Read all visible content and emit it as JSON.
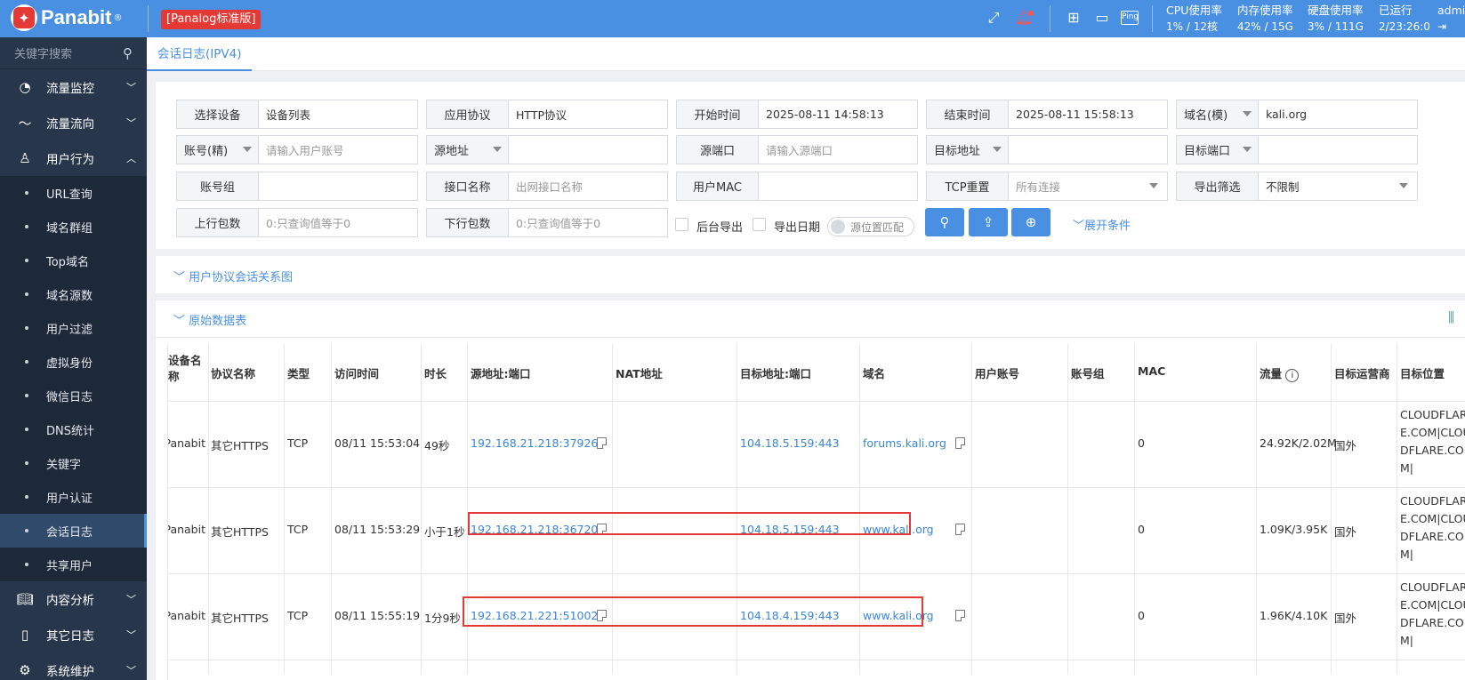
{
  "topbar": {
    "brand": "Panabit",
    "reg": "®",
    "edition": "[Panalog标准版]",
    "stats": [
      {
        "label": "CPU使用率",
        "value": "1% / 12核"
      },
      {
        "label": "内存使用率",
        "value": "42% / 15G"
      },
      {
        "label": "硬盘使用率",
        "value": "3% / 111G"
      },
      {
        "label": "已运行",
        "value": "2/23:26:0"
      },
      {
        "label": "admi",
        "value": ""
      }
    ],
    "ping_label": "Ping"
  },
  "sidebar": {
    "search_placeholder": "关键字搜索",
    "groups": [
      {
        "label": "流量监控"
      },
      {
        "label": "流量流向"
      },
      {
        "label": "用户行为"
      },
      {
        "label": "内容分析"
      },
      {
        "label": "其它日志"
      },
      {
        "label": "系统维护"
      }
    ],
    "sub_items": [
      "URL查询",
      "域名群组",
      "Top域名",
      "域名源数",
      "用户过滤",
      "虚拟身份",
      "微信日志",
      "DNS统计",
      "关键字",
      "用户认证",
      "会话日志",
      "共享用户"
    ]
  },
  "tab": {
    "label": "会话日志(IPV4)"
  },
  "filter": {
    "row1": [
      {
        "label": "选择设备",
        "value": "设备列表"
      },
      {
        "label": "应用协议",
        "value": "HTTP协议"
      },
      {
        "label": "开始时间",
        "value": "2025-08-11 14:58:13"
      },
      {
        "label": "结束时间",
        "value": "2025-08-11 15:58:13"
      },
      {
        "label": "域名(模)",
        "value": "kali.org"
      }
    ],
    "row2": [
      {
        "label": "账号(精)",
        "placeholder": "请输入用户账号"
      },
      {
        "label": "源地址",
        "placeholder": ""
      },
      {
        "label": "源端口",
        "placeholder": "请输入源端口"
      },
      {
        "label": "目标地址",
        "placeholder": ""
      },
      {
        "label": "目标端口",
        "placeholder": ""
      }
    ],
    "row3": [
      {
        "label": "账号组",
        "value": ""
      },
      {
        "label": "接口名称",
        "placeholder": "出网接口名称"
      },
      {
        "label": "用户MAC",
        "value": ""
      },
      {
        "label": "TCP重置",
        "placeholder": "所有连接"
      },
      {
        "label": "导出筛选",
        "value": "不限制"
      }
    ],
    "row4": [
      {
        "label": "上行包数",
        "placeholder": "0:只查询值等于0"
      },
      {
        "label": "下行包数",
        "placeholder": "0:只查询值等于0"
      }
    ],
    "bg_export": "后台导出",
    "export_date": "导出日期",
    "toggle_label": "源位置匹配",
    "expand_label": "展开条件"
  },
  "sections": {
    "relation": "用户协议会话关系图",
    "raw": "原始数据表"
  },
  "table": {
    "headers": [
      "设备名称",
      "协议名称",
      "类型",
      "访问时间",
      "时长",
      "源地址:端口",
      "NAT地址",
      "目标地址:端口",
      "域名",
      "用户账号",
      "账号组",
      "MAC",
      "流量",
      "目标运营商",
      "目标位置"
    ],
    "rows": [
      {
        "device": "Panabit",
        "proto": "其它HTTPS",
        "type": "TCP",
        "time": "08/11 15:53:04",
        "dur": "49秒",
        "src": "192.168.21.218:37926",
        "nat": "",
        "dst": "104.18.5.159:443",
        "domain": "forums.kali.org",
        "account": "",
        "group": "",
        "mac": "0",
        "traffic": "24.92K/2.02M",
        "isp": "国外",
        "loc": "CLOUDFLARE.COM|CLOUDFLARE.COM|"
      },
      {
        "device": "Panabit",
        "proto": "其它HTTPS",
        "type": "TCP",
        "time": "08/11 15:53:29",
        "dur": "小于1秒",
        "src": "192.168.21.218:36720",
        "nat": "",
        "dst": "104.18.5.159:443",
        "domain": "www.kali.org",
        "account": "",
        "group": "",
        "mac": "0",
        "traffic": "1.09K/3.95K",
        "isp": "国外",
        "loc": "CLOUDFLARE.COM|CLOUDFLARE.COM|"
      },
      {
        "device": "Panabit",
        "proto": "其它HTTPS",
        "type": "TCP",
        "time": "08/11 15:55:19",
        "dur": "1分9秒",
        "src": "192.168.21.221:51002",
        "nat": "",
        "dst": "104.18.4.159:443",
        "domain": "www.kali.org",
        "account": "",
        "group": "",
        "mac": "0",
        "traffic": "1.96K/4.10K",
        "isp": "国外",
        "loc": "CLOUDFLARE.COM|CLOUDFLARE.COM|"
      }
    ]
  },
  "colors": {
    "primary": "#4a90e2",
    "sidebar": "#27364a",
    "highlight": "#e53935"
  }
}
